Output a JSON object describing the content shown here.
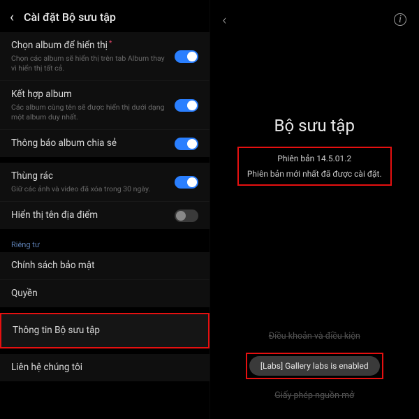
{
  "left": {
    "title": "Cài đặt Bộ sưu tập",
    "groups": [
      {
        "rows": [
          {
            "title": "Chọn album để hiển thị",
            "asterisk": true,
            "sub": "Chọn các album sẽ hiển thị trên tab Album thay vì hiển thị tất cả.",
            "toggle": "on"
          },
          {
            "title": "Kết hợp album",
            "sub": "Các album cùng tên sẽ được hiển thị dưới dạng một album duy nhất.",
            "toggle": "on"
          },
          {
            "title": "Thông báo album chia sẻ",
            "toggle": "on"
          }
        ]
      },
      {
        "rows": [
          {
            "title": "Thùng rác",
            "sub": "Giữ các ảnh và video đã xóa trong 30 ngày.",
            "toggle": "on"
          },
          {
            "title": "Hiển thị tên địa điểm",
            "toggle": "off"
          }
        ]
      }
    ],
    "privacy_label": "Riêng tư",
    "privacy_rows": [
      {
        "title": "Chính sách bảo mật"
      },
      {
        "title": "Quyền"
      }
    ],
    "about_row": "Thông tin Bộ sưu tập",
    "contact_row": "Liên hệ chúng tôi"
  },
  "right": {
    "app_name": "Bộ sưu tập",
    "version": "Phiên bản 14.5.01.2",
    "update_msg": "Phiên bản mới nhất đã được cài đặt.",
    "link_terms": "Điều khoản và điều kiện",
    "toast": "[Labs] Gallery labs is enabled",
    "link_license": "Giấy phép nguồn mở"
  }
}
